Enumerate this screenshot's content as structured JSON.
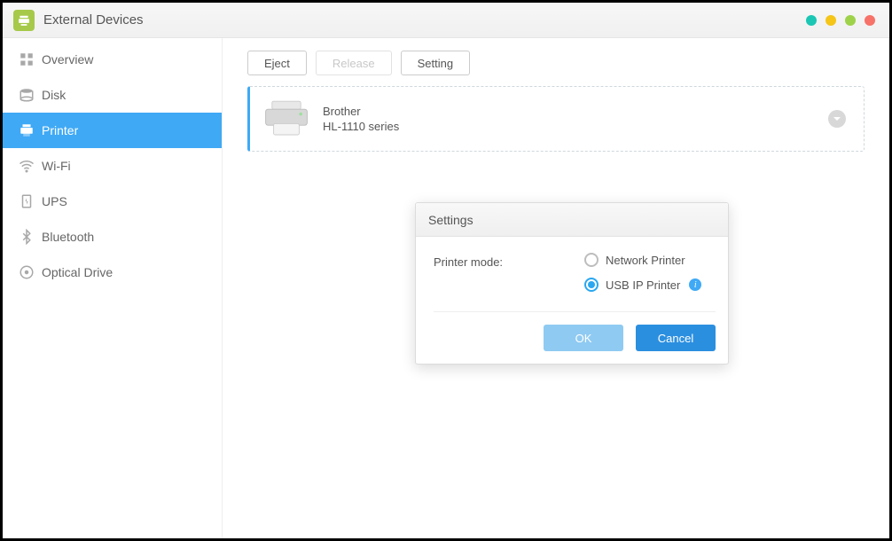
{
  "header": {
    "title": "External Devices"
  },
  "sidebar": {
    "items": [
      {
        "label": "Overview"
      },
      {
        "label": "Disk"
      },
      {
        "label": "Printer"
      },
      {
        "label": "Wi-Fi"
      },
      {
        "label": "UPS"
      },
      {
        "label": "Bluetooth"
      },
      {
        "label": "Optical Drive"
      }
    ]
  },
  "toolbar": {
    "eject_label": "Eject",
    "release_label": "Release",
    "setting_label": "Setting"
  },
  "device": {
    "brand": "Brother",
    "model": "HL-1110 series"
  },
  "modal": {
    "title": "Settings",
    "label": "Printer mode:",
    "option1": "Network Printer",
    "option2": "USB IP Printer",
    "ok": "OK",
    "cancel": "Cancel"
  }
}
